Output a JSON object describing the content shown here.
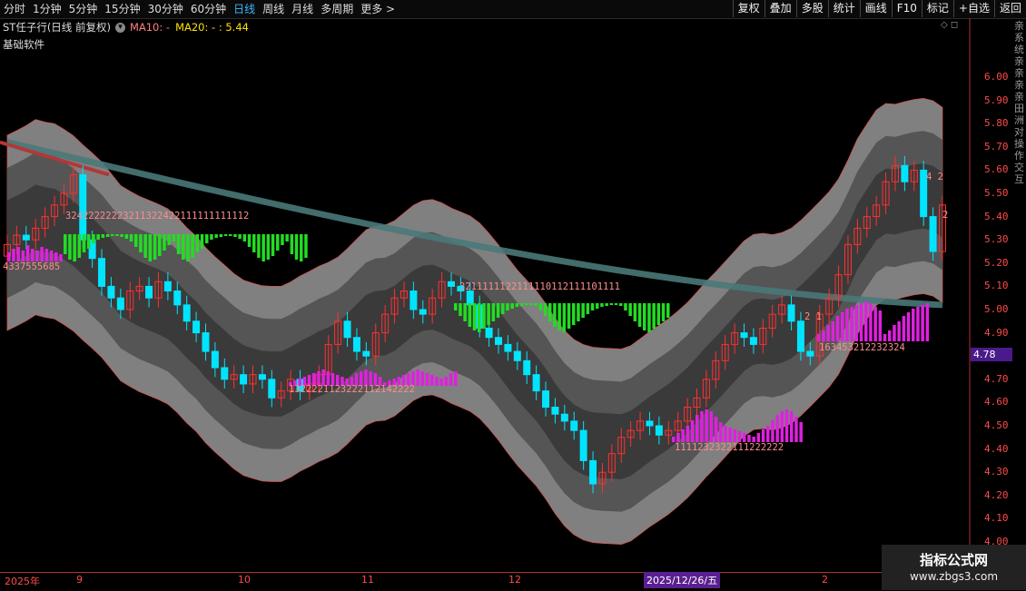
{
  "toolbar": {
    "tabs": [
      "分时",
      "1分钟",
      "5分钟",
      "15分钟",
      "30分钟",
      "60分钟",
      "日线",
      "周线",
      "月线",
      "多周期",
      "更多"
    ],
    "active_tab": "日线",
    "right_buttons": [
      "复权",
      "叠加",
      "多股",
      "统计",
      "画线",
      "F10",
      "标记",
      "+自选",
      "返回"
    ]
  },
  "title": {
    "name": "ST任子行(日线 前复权)",
    "ma10": "MA10: -",
    "ma20": "MA20: - : 5.44",
    "software": "基础软件"
  },
  "price_axis": [
    "6.00",
    "5.90",
    "5.80",
    "5.70",
    "5.60",
    "5.50",
    "5.40",
    "5.30",
    "5.20",
    "5.10",
    "5.00",
    "4.90",
    "4.80",
    "4.70",
    "4.60",
    "4.50",
    "4.40",
    "4.30",
    "4.20",
    "4.10",
    "4.00"
  ],
  "current_price": "4.78",
  "right_strip_text": "亲系统亲亲亲亲田洲对操作交互",
  "date_axis": {
    "labels": [
      "2025年",
      "9",
      "10",
      "11",
      "12",
      "2"
    ],
    "selected": "2025/12/26/五"
  },
  "counters": [
    "32422222223211322422111111111112",
    "4337555685",
    "3211111122111110112111101111",
    "1322221123222112142222",
    "1111232322111222222",
    "2 1",
    "163453212232324",
    "4 2",
    "2"
  ],
  "watermark": {
    "line1": "指标公式网",
    "line2": "www.zbgs3.com"
  },
  "colors": {
    "up": "#ff3030",
    "down": "#00e5ff",
    "volume_pos": "#e020e0",
    "volume_neg": "#22dd22",
    "band_outer": "#808080",
    "band_mid": "#555555",
    "band_inner": "#3a3a3a",
    "ma_long": "#4a7878"
  },
  "chart_data": {
    "type": "candlestick",
    "ylim": [
      4.0,
      6.0
    ],
    "candles_close": [
      5.28,
      5.32,
      5.3,
      5.35,
      5.4,
      5.45,
      5.5,
      5.58,
      5.3,
      5.22,
      5.1,
      5.05,
      5.0,
      5.08,
      5.1,
      5.05,
      5.12,
      5.08,
      5.02,
      4.95,
      4.9,
      4.82,
      4.75,
      4.7,
      4.72,
      4.68,
      4.72,
      4.7,
      4.62,
      4.65,
      4.7,
      4.65,
      4.68,
      4.72,
      4.85,
      4.95,
      4.88,
      4.82,
      4.8,
      4.9,
      4.98,
      5.05,
      5.08,
      5.0,
      4.98,
      5.05,
      5.12,
      5.1,
      5.08,
      5.02,
      4.92,
      4.88,
      4.85,
      4.82,
      4.78,
      4.72,
      4.65,
      4.58,
      4.55,
      4.52,
      4.48,
      4.35,
      4.25,
      4.3,
      4.38,
      4.45,
      4.48,
      4.52,
      4.5,
      4.46,
      4.48,
      4.52,
      4.58,
      4.62,
      4.7,
      4.78,
      4.85,
      4.9,
      4.88,
      4.85,
      4.92,
      4.98,
      5.02,
      4.95,
      4.82,
      4.8,
      4.98,
      5.05,
      5.15,
      5.28,
      5.35,
      5.4,
      5.45,
      5.55,
      5.62,
      5.55,
      5.6,
      5.4,
      5.25,
      5.45
    ]
  }
}
